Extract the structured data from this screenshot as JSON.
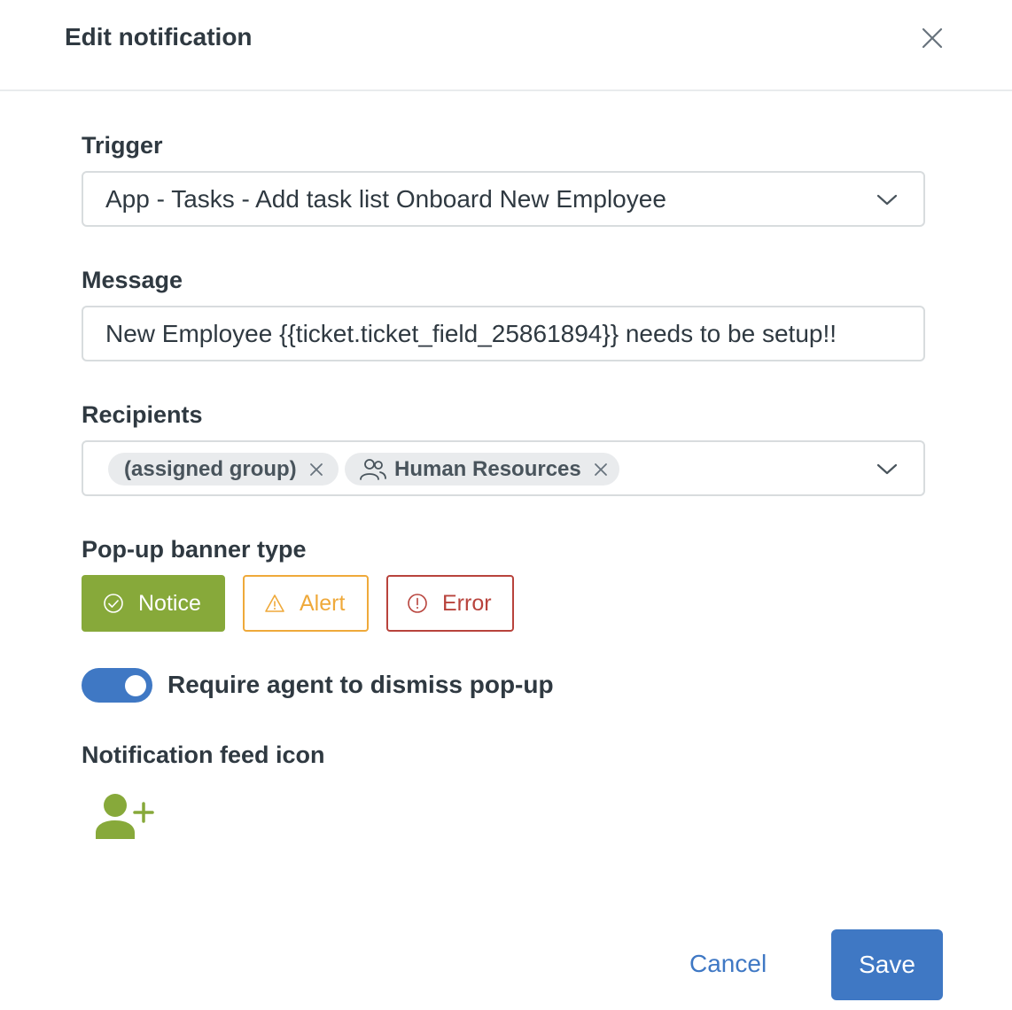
{
  "dialog": {
    "title": "Edit notification",
    "close_icon": "close-icon"
  },
  "trigger": {
    "label": "Trigger",
    "value": "App - Tasks - Add task list Onboard New Employee"
  },
  "message": {
    "label": "Message",
    "value": "New Employee {{ticket.ticket_field_25861894}} needs to be setup!!"
  },
  "recipients": {
    "label": "Recipients",
    "tags": [
      {
        "label": "(assigned group)",
        "icon": null
      },
      {
        "label": "Human Resources",
        "icon": "group-icon"
      }
    ]
  },
  "banner_type": {
    "label": "Pop-up banner type",
    "options": [
      {
        "label": "Notice",
        "icon": "check-circle-icon",
        "selected": true,
        "color": "#87a93a"
      },
      {
        "label": "Alert",
        "icon": "warning-triangle-icon",
        "selected": false,
        "color": "#efa93a"
      },
      {
        "label": "Error",
        "icon": "error-circle-icon",
        "selected": false,
        "color": "#b8433c"
      }
    ]
  },
  "dismiss_toggle": {
    "label": "Require agent to dismiss pop-up",
    "on": true
  },
  "feed_icon": {
    "label": "Notification feed icon",
    "icon": "user-plus-icon",
    "color": "#87a93a"
  },
  "footer": {
    "cancel_label": "Cancel",
    "save_label": "Save"
  },
  "colors": {
    "primary": "#3f78c4",
    "text": "#2f3941",
    "border": "#d8dcde"
  }
}
